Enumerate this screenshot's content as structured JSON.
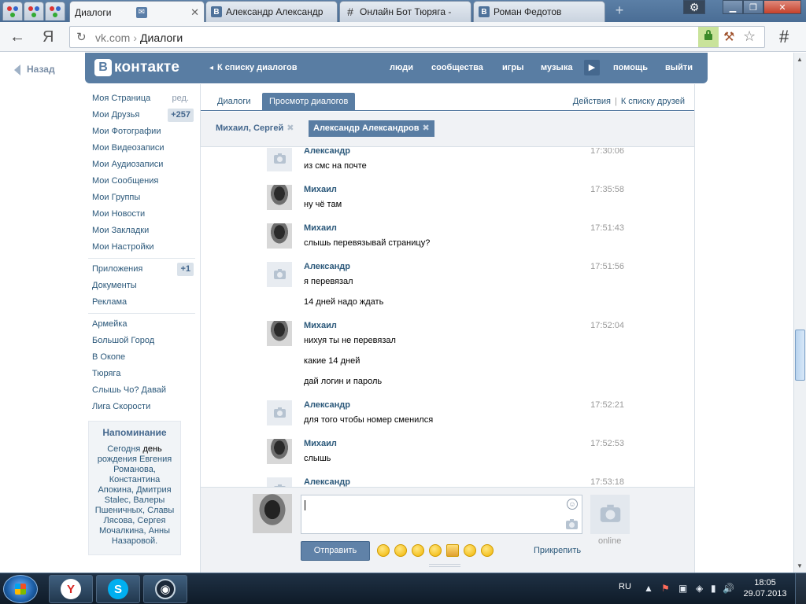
{
  "browser": {
    "tabs": [
      {
        "title": "Диалоги",
        "icon": "message-icon",
        "active": true
      },
      {
        "title": "Александр Александр",
        "icon": "vk-icon",
        "active": false
      },
      {
        "title": "Онлайн Бот Тюряга -",
        "icon": "hash-icon",
        "active": false
      },
      {
        "title": "Роман Федотов",
        "icon": "vk-icon",
        "active": false
      }
    ],
    "address": {
      "host": "vk.com",
      "separator": "›",
      "path": "Диалоги"
    },
    "back_glyph": "←",
    "yandex_glyph": "Я",
    "reload_glyph": "↻",
    "star_glyph": "☆",
    "menu_glyph": "#"
  },
  "page": {
    "back_link": "Назад",
    "header": {
      "logo_letter": "В",
      "logo_text": "контакте",
      "back_to_list": "К списку диалогов",
      "nav": [
        "люди",
        "сообщества",
        "игры",
        "музыка",
        "помощь",
        "выйти"
      ]
    },
    "left_menu": {
      "main": [
        {
          "label": "Моя Страница",
          "extra": "ред."
        },
        {
          "label": "Мои Друзья",
          "badge": "+257"
        },
        {
          "label": "Мои Фотографии"
        },
        {
          "label": "Мои Видеозаписи"
        },
        {
          "label": "Мои Аудиозаписи"
        },
        {
          "label": "Мои Сообщения"
        },
        {
          "label": "Мои Группы"
        },
        {
          "label": "Мои Новости"
        },
        {
          "label": "Мои Закладки"
        },
        {
          "label": "Мои Настройки"
        }
      ],
      "apps": [
        {
          "label": "Приложения",
          "badge": "+1"
        },
        {
          "label": "Документы"
        },
        {
          "label": "Реклама"
        }
      ],
      "groups": [
        {
          "label": "Армейка"
        },
        {
          "label": "Большой Город"
        },
        {
          "label": "В Окопе"
        },
        {
          "label": "Тюряга"
        },
        {
          "label": "Слышь Чо? Давай"
        },
        {
          "label": "Лига Скорости"
        }
      ]
    },
    "reminder": {
      "title": "Напоминание",
      "lead": "Сегодня",
      "word": "день",
      "body": "рождения Евгения Романова, Константина Апокина, Дмитрия Stalec, Валеры Пшеничных, Славы Лясова, Сергея Мочалкина, Анны Назаровой."
    },
    "tabs": {
      "dialogs": "Диалоги",
      "view": "Просмотр диалогов",
      "actions": "Действия",
      "separator": "|",
      "to_friends": "К списку друзей"
    },
    "peers": [
      {
        "label": "Михаил, Сергей",
        "active": false
      },
      {
        "label": "Александр Александров",
        "active": true
      }
    ],
    "messages": [
      {
        "author": "Александр",
        "time": "17:30:06",
        "avatar": "camera",
        "lines": [
          "из смс на почте"
        ]
      },
      {
        "author": "Михаил",
        "time": "17:35:58",
        "avatar": "photo",
        "lines": [
          "ну чё там"
        ]
      },
      {
        "author": "Михаил",
        "time": "17:51:43",
        "avatar": "photo",
        "lines": [
          "слышь перевязывай страницу?"
        ]
      },
      {
        "author": "Александр",
        "time": "17:51:56",
        "avatar": "camera",
        "lines": [
          "я перевязал",
          "14 дней надо ждать"
        ]
      },
      {
        "author": "Михаил",
        "time": "17:52:04",
        "avatar": "photo",
        "lines": [
          "нихуя ты не перевязал",
          "какие 14 дней",
          "дай логин и пароль"
        ]
      },
      {
        "author": "Александр",
        "time": "17:52:21",
        "avatar": "camera",
        "lines": [
          "для того чтобы номер сменился"
        ]
      },
      {
        "author": "Михаил",
        "time": "17:52:53",
        "avatar": "photo",
        "lines": [
          "слышь"
        ]
      },
      {
        "author": "Александр",
        "time": "17:53:18",
        "avatar": "camera",
        "lines": []
      }
    ],
    "composer": {
      "message_value": "",
      "send_label": "Отправить",
      "attach_label": "Прикрепить",
      "peer_status": "online",
      "emoji": [
        "😌",
        "😕",
        "😨",
        "😊",
        "🍻",
        "😥",
        "😁"
      ]
    }
  },
  "taskbar": {
    "apps": [
      {
        "name": "yandex-browser",
        "glyph": "Y",
        "color": "#d8231f"
      },
      {
        "name": "skype",
        "glyph": "S",
        "color": "#00aff0"
      },
      {
        "name": "steam",
        "glyph": "◉",
        "color": "#1b2838"
      }
    ],
    "lang": "RU",
    "tray": [
      "▲",
      "⚑",
      "▣",
      "◈",
      "▮",
      "🔊"
    ],
    "clock_time": "18:05",
    "clock_date": "29.07.2013"
  },
  "colors": {
    "vk_blue": "#597da3",
    "link": "#2b587a",
    "taskbar": "#1a2a3b"
  }
}
